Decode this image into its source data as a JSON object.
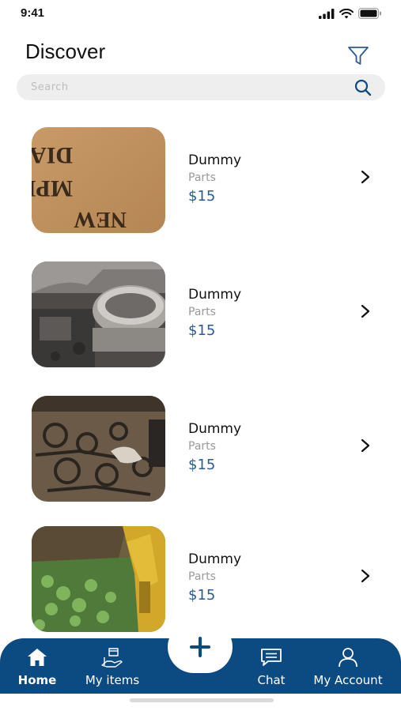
{
  "status_bar": {
    "time": "9:41"
  },
  "header": {
    "title": "Discover"
  },
  "search": {
    "placeholder": "Search"
  },
  "items": [
    {
      "name": "Dummy",
      "category": "Parts",
      "price": "$15",
      "image": "radiator-box-photo"
    },
    {
      "name": "Dummy",
      "category": "Parts",
      "price": "$15",
      "image": "metal-engine-part-photo"
    },
    {
      "name": "Dummy",
      "category": "Parts",
      "price": "$15",
      "image": "scrap-parts-pile-photo"
    },
    {
      "name": "Dummy",
      "category": "Parts",
      "price": "$15",
      "image": "yellow-machinery-photo"
    }
  ],
  "tab_bar": {
    "home": "Home",
    "my_items": "My items",
    "chat": "Chat",
    "my_account": "My Account"
  },
  "colors": {
    "brand": "#0c4a82",
    "price": "#2b5b95",
    "search_bg": "#eeeeee"
  }
}
